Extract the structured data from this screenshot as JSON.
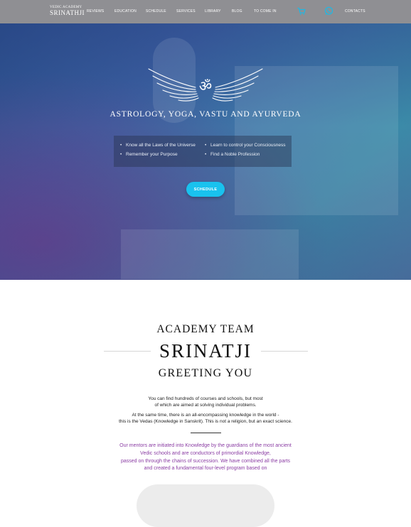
{
  "header": {
    "logo_small": "VEDIC ACADEMY",
    "logo_big": "SRINATHJI",
    "nav": [
      "REVIEWS",
      "EDUCATION",
      "SCHEDULE",
      "SERVICES",
      "LIBRARY",
      "BLOG",
      "TO COME IN"
    ],
    "contacts": "CONTACTS",
    "icons": [
      "cart-icon",
      "whatsapp-icon"
    ],
    "accent": "#1cb9e6"
  },
  "hero": {
    "title": "ASTROLOGY, YOGA, VASTU AND AYURVEDA",
    "bullets": [
      "Know all the Laws of the Universe",
      "Learn to control your Consciousness",
      "Remember your Purpose",
      "Find a Noble Profession"
    ],
    "button": "SCHEDULE",
    "button_color": "#19c2ee"
  },
  "intro": {
    "line1": "ACADEMY TEAM",
    "line2": "SRINATJI",
    "line3": "GREETING YOU",
    "p1": [
      "You can find hundreds of courses and schools, but most",
      "of which are aimed at solving individual problems."
    ],
    "p2": [
      "At the same time, there is an all-encompassing knowledge in the world -",
      "this is the Vedas (Knowledge in Sanskrit). This is not a religion, but an exact science."
    ],
    "purple": [
      "Our mentors are initiated into Knowledge by the guardians of the most ancient",
      "Vedic schools and are conductors of primordial Knowledge,",
      "passed on through the chains of succession. We have combined all the parts",
      "and created a fundamental four-level program based on"
    ],
    "purple_color": "#8a3ca3"
  }
}
